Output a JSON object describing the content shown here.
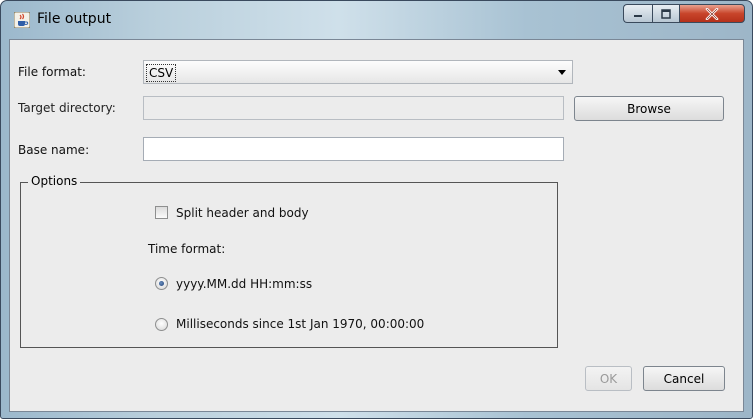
{
  "window": {
    "title": "File output",
    "icon": "java-cup-icon"
  },
  "form": {
    "file_format_label": "File format:",
    "file_format_value": "CSV",
    "target_directory_label": "Target directory:",
    "target_directory_value": "",
    "browse_label": "Browse",
    "base_name_label": "Base name:",
    "base_name_value": ""
  },
  "options": {
    "title": "Options",
    "split_label": "Split header and body",
    "split_checked": false,
    "time_format_label": "Time format:",
    "time_formats": [
      {
        "label": "yyyy.MM.dd HH:mm:ss",
        "selected": true
      },
      {
        "label": "Milliseconds since 1st Jan 1970, 00:00:00",
        "selected": false
      }
    ]
  },
  "buttons": {
    "ok_label": "OK",
    "ok_enabled": false,
    "cancel_label": "Cancel"
  }
}
